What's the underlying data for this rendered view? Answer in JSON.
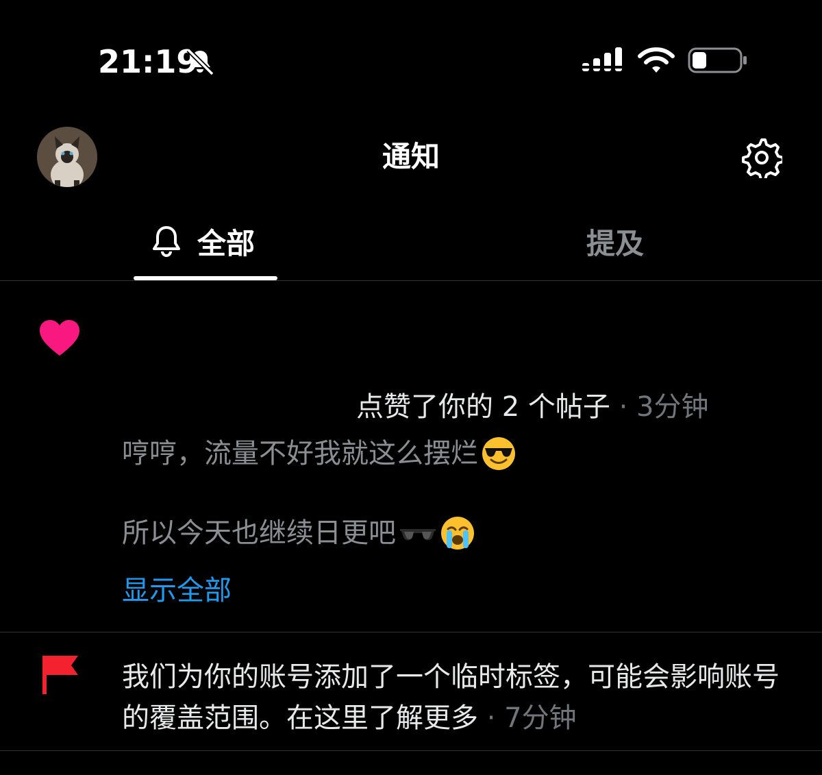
{
  "status_bar": {
    "time": "21:19",
    "silent_icon": "bell-slash-icon",
    "signal_icon": "cellular-signal-icon",
    "wifi_icon": "wifi-icon",
    "battery_icon": "battery-low-icon"
  },
  "header": {
    "title": "通知",
    "avatar": "avatar-siamese-cat",
    "settings_icon": "gear-icon"
  },
  "tabs": [
    {
      "label": "全部",
      "icon": "bell-icon",
      "selected": true
    },
    {
      "label": "提及",
      "selected": false
    }
  ],
  "notifications": [
    {
      "type": "like",
      "icon": "heart-icon",
      "action": "点赞了你的 2 个帖子",
      "meta": " · 3分钟",
      "line1": "哼哼，流量不好我就这么摆烂",
      "line1_emoji": "smiling-face-with-sunglasses",
      "line2": "所以今天也继续日更吧",
      "line2_emojis": [
        "dark-sunglasses",
        "loudly-crying-face"
      ],
      "show_all": "显示全部"
    },
    {
      "type": "label",
      "icon": "flag-icon",
      "text": "我们为你的账号添加了一个临时标签，可能会影响账号的覆盖范围。在这里了解更多",
      "meta": " · 7分钟"
    }
  ],
  "colors": {
    "background": "#000000",
    "accent_link": "#1d9bf0",
    "like_heart": "#f91880",
    "flag": "#f4212e",
    "muted_text": "#71767b"
  }
}
